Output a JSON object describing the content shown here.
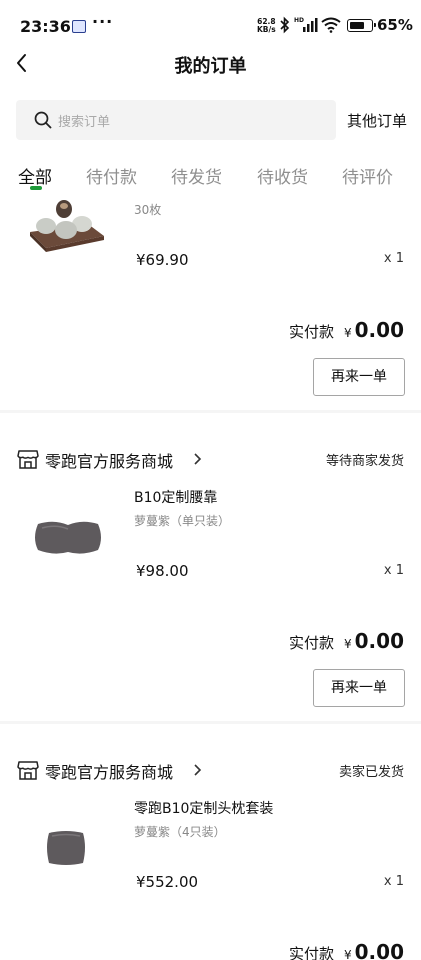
{
  "status_bar": {
    "time": "23:36",
    "dots": "···",
    "net_speed_value": "62.8",
    "net_speed_unit": "KB/s",
    "hd": "HD",
    "battery_percent": "65",
    "battery_label": "65%"
  },
  "header": {
    "title": "我的订单"
  },
  "search": {
    "placeholder": "搜索订单",
    "other_orders": "其他订单"
  },
  "tabs": [
    {
      "label": "全部",
      "active": true
    },
    {
      "label": "待付款",
      "active": false
    },
    {
      "label": "待发货",
      "active": false
    },
    {
      "label": "待收货",
      "active": false
    },
    {
      "label": "待评价",
      "active": false
    }
  ],
  "orders": [
    {
      "spec": "30枚",
      "price": "¥69.90",
      "quantity": "x 1",
      "paid_label": "实付款",
      "currency": "¥",
      "paid_amount": "0.00",
      "reorder_label": "再来一单"
    },
    {
      "shop_name": "零跑官方服务商城",
      "status": "等待商家发货",
      "product_name": "B10定制腰靠",
      "spec": "萝蔓紫（单只装）",
      "price": "¥98.00",
      "quantity": "x 1",
      "paid_label": "实付款",
      "currency": "¥",
      "paid_amount": "0.00",
      "reorder_label": "再来一单"
    },
    {
      "shop_name": "零跑官方服务商城",
      "status": "卖家已发货",
      "product_name": "零跑B10定制头枕套装",
      "spec": "萝蔓紫（4只装）",
      "price": "¥552.00",
      "quantity": "x 1",
      "paid_label": "实付款",
      "currency": "¥",
      "paid_amount": "0.00"
    }
  ],
  "colors": {
    "accent": "#1f9b3a",
    "search_bg": "#f3f3f3",
    "muted_text": "#8f8f8f"
  }
}
